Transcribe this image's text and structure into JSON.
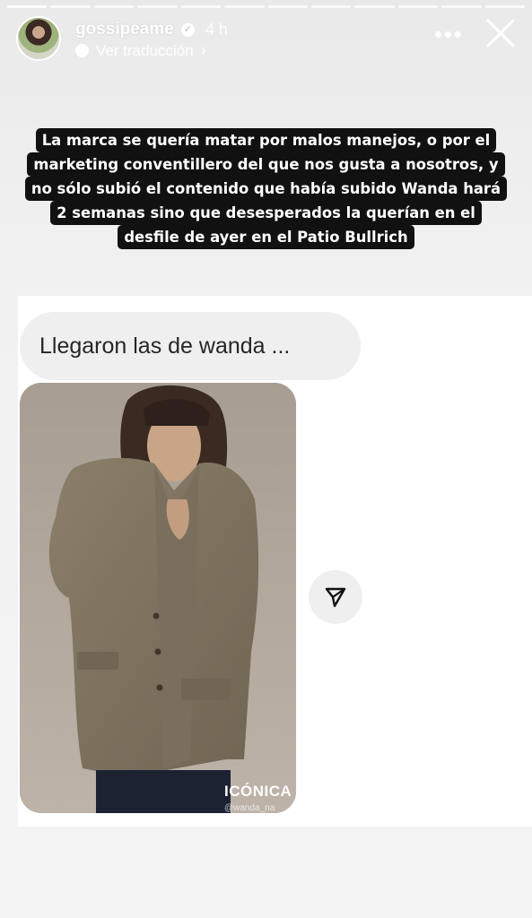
{
  "story": {
    "segments": 12,
    "active_segment": 1
  },
  "header": {
    "username": "gossipeame",
    "timestamp": "4 h",
    "translate_label": "Ver traducción"
  },
  "caption": {
    "lines": [
      "La marca se quería matar por malos manejos, o por el",
      "marketing conventillero del que nos gusta a nosotros, y",
      "no sólo subió el contenido que había subido Wanda hará",
      "2 semanas sino que desesperados la querían en el",
      "desfile de ayer en el Patio Bullrich"
    ]
  },
  "message": {
    "text": "Llegaron las de wanda ...",
    "photo_brand": "ICÓNICA",
    "photo_handle": "@wanda_na"
  },
  "icons": {
    "avatar": "profile-photo",
    "verified": "verified-badge-icon",
    "translate": "globe-icon",
    "more": "more-options-icon",
    "close": "close-icon",
    "share": "send-icon"
  },
  "colors": {
    "caption_bg": "#111111",
    "caption_text": "#ffffff",
    "bubble_bg": "#efefef",
    "message_text": "#262626"
  }
}
